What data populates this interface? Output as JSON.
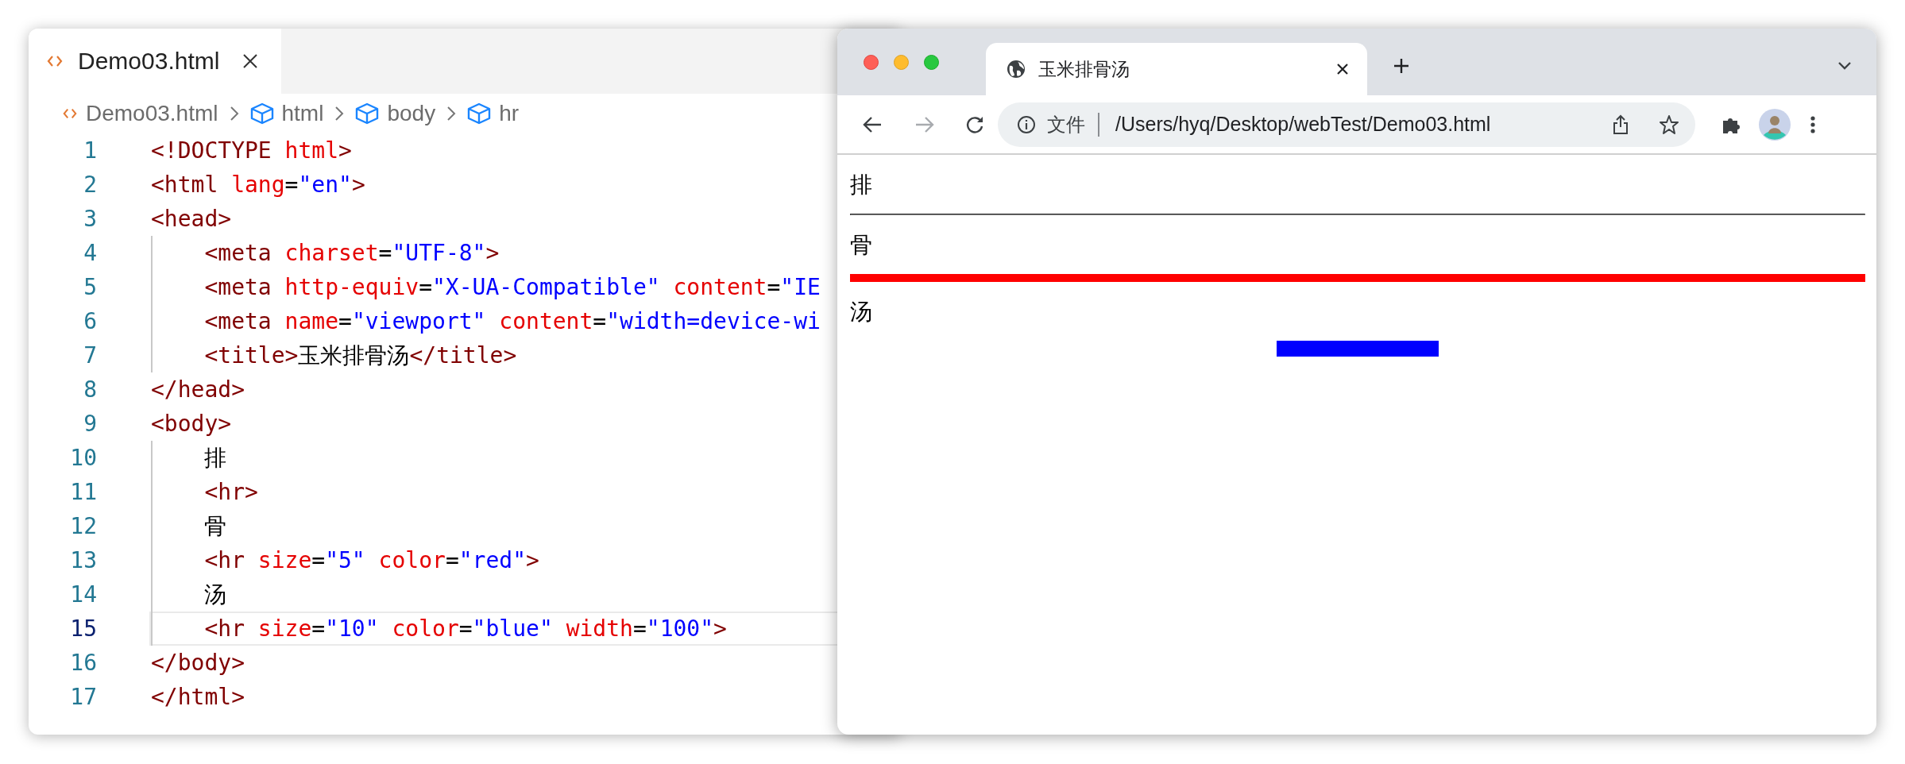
{
  "editor": {
    "tab": {
      "label": "Demo03.html",
      "selected": true
    },
    "breadcrumb": [
      {
        "kind": "file",
        "label": "Demo03.html"
      },
      {
        "kind": "element",
        "label": "html"
      },
      {
        "kind": "element",
        "label": "body"
      },
      {
        "kind": "element",
        "label": "hr"
      }
    ],
    "lines": [
      {
        "number": "1",
        "current": false,
        "tokens": [
          {
            "kind": "tag",
            "text": "<!DOCTYPE "
          },
          {
            "kind": "attr",
            "text": "html"
          },
          {
            "kind": "tag",
            "text": ">"
          }
        ]
      },
      {
        "number": "2",
        "current": false,
        "tokens": [
          {
            "kind": "tag",
            "text": "<html "
          },
          {
            "kind": "attr",
            "text": "lang"
          },
          {
            "kind": "plain",
            "text": "="
          },
          {
            "kind": "value",
            "text": "\"en\""
          },
          {
            "kind": "tag",
            "text": ">"
          }
        ]
      },
      {
        "number": "3",
        "current": false,
        "tokens": [
          {
            "kind": "tag",
            "text": "<head>"
          }
        ],
        "children": [
          {
            "number": "4",
            "current": false,
            "tokens": [
              {
                "kind": "tag",
                "text": "<meta "
              },
              {
                "kind": "attr",
                "text": "charset"
              },
              {
                "kind": "plain",
                "text": "="
              },
              {
                "kind": "value",
                "text": "\"UTF-8\""
              },
              {
                "kind": "tag",
                "text": ">"
              }
            ]
          },
          {
            "number": "5",
            "current": false,
            "tokens": [
              {
                "kind": "tag",
                "text": "<meta "
              },
              {
                "kind": "attr",
                "text": "http-equiv"
              },
              {
                "kind": "plain",
                "text": "="
              },
              {
                "kind": "value",
                "text": "\"X-UA-Compatible\" "
              },
              {
                "kind": "attr",
                "text": "content"
              },
              {
                "kind": "plain",
                "text": "="
              },
              {
                "kind": "value",
                "text": "\"IE"
              }
            ]
          },
          {
            "number": "6",
            "current": false,
            "tokens": [
              {
                "kind": "tag",
                "text": "<meta "
              },
              {
                "kind": "attr",
                "text": "name"
              },
              {
                "kind": "plain",
                "text": "="
              },
              {
                "kind": "value",
                "text": "\"viewport\" "
              },
              {
                "kind": "attr",
                "text": "content"
              },
              {
                "kind": "plain",
                "text": "="
              },
              {
                "kind": "value",
                "text": "\"width=device-wi"
              }
            ]
          },
          {
            "number": "7",
            "current": false,
            "tokens": [
              {
                "kind": "tag",
                "text": "<title>"
              },
              {
                "kind": "plain",
                "text": "玉米排骨汤"
              },
              {
                "kind": "tag",
                "text": "</title>"
              }
            ]
          }
        ]
      },
      {
        "number": "8",
        "current": false,
        "tokens": [
          {
            "kind": "tag",
            "text": "</head>"
          }
        ]
      },
      {
        "number": "9",
        "current": false,
        "tokens": [
          {
            "kind": "tag",
            "text": "<body>"
          }
        ],
        "children": [
          {
            "number": "10",
            "current": false,
            "tokens": [
              {
                "kind": "plain",
                "text": "排"
              }
            ]
          },
          {
            "number": "11",
            "current": false,
            "tokens": [
              {
                "kind": "tag",
                "text": "<hr>"
              }
            ]
          },
          {
            "number": "12",
            "current": false,
            "tokens": [
              {
                "kind": "plain",
                "text": "骨"
              }
            ]
          },
          {
            "number": "13",
            "current": false,
            "tokens": [
              {
                "kind": "tag",
                "text": "<hr "
              },
              {
                "kind": "attr",
                "text": "size"
              },
              {
                "kind": "plain",
                "text": "="
              },
              {
                "kind": "value",
                "text": "\"5\" "
              },
              {
                "kind": "attr",
                "text": "color"
              },
              {
                "kind": "plain",
                "text": "="
              },
              {
                "kind": "value",
                "text": "\"red\""
              },
              {
                "kind": "tag",
                "text": ">"
              }
            ]
          },
          {
            "number": "14",
            "current": false,
            "tokens": [
              {
                "kind": "plain",
                "text": "汤"
              }
            ]
          },
          {
            "number": "15",
            "current": true,
            "tokens": [
              {
                "kind": "tag",
                "text": "<hr "
              },
              {
                "kind": "attr",
                "text": "size"
              },
              {
                "kind": "plain",
                "text": "="
              },
              {
                "kind": "value",
                "text": "\"10\" "
              },
              {
                "kind": "attr",
                "text": "color"
              },
              {
                "kind": "plain",
                "text": "="
              },
              {
                "kind": "value",
                "text": "\"blue\" "
              },
              {
                "kind": "attr",
                "text": "width"
              },
              {
                "kind": "plain",
                "text": "="
              },
              {
                "kind": "value",
                "text": "\"100\""
              },
              {
                "kind": "tag",
                "text": ">"
              }
            ]
          }
        ]
      },
      {
        "number": "16",
        "current": false,
        "tokens": [
          {
            "kind": "tag",
            "text": "</body>"
          }
        ]
      },
      {
        "number": "17",
        "current": false,
        "tokens": [
          {
            "kind": "tag",
            "text": "</html>"
          }
        ]
      }
    ]
  },
  "browser": {
    "tab": {
      "title": "玉米排骨汤",
      "selected": true
    },
    "back": {
      "disabled": false
    },
    "forward": {
      "disabled": true
    },
    "address": {
      "scheme_label": "文件",
      "url": "/Users/hyq/Desktop/webTest/Demo03.html"
    },
    "content": [
      {
        "kind": "text",
        "text": "排"
      },
      {
        "kind": "rule",
        "color": "#808080"
      },
      {
        "kind": "text",
        "text": "骨"
      },
      {
        "kind": "thick-rule",
        "color": "#ff0000"
      },
      {
        "kind": "text",
        "text": "汤"
      },
      {
        "kind": "short-rule",
        "color": "#0000ff"
      }
    ]
  }
}
